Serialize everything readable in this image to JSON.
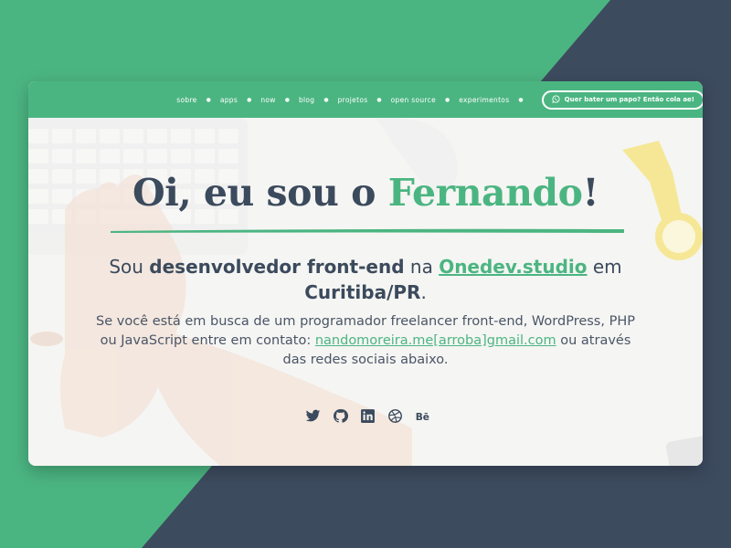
{
  "colors": {
    "accent": "#4bb581",
    "dark": "#3b4a5c",
    "background_dark": "#3d4b5f"
  },
  "nav": {
    "items": [
      {
        "label": "sobre"
      },
      {
        "label": "apps"
      },
      {
        "label": "now"
      },
      {
        "label": "blog"
      },
      {
        "label": "projetos"
      },
      {
        "label": "open source"
      },
      {
        "label": "experimentos"
      }
    ],
    "cta_label": "Quer bater um papo? Então cola ae!",
    "cta_icon": "whatsapp-icon"
  },
  "hero": {
    "title_pre": "Oi, eu sou o ",
    "title_name": "Fernando",
    "title_post": "!",
    "tag_1": "Sou ",
    "tag_bold": "desenvolvedor front-end",
    "tag_2": " na ",
    "tag_link": "Onedev.studio",
    "tag_3": " em ",
    "tag_city": "Curitiba/PR",
    "tag_4": ".",
    "desc_1": "Se você está em busca de um programador freelancer front-end, WordPress, PHP ou JavaScript entre em contato: ",
    "desc_email": "nandomoreira.me[arroba]gmail.com",
    "desc_2": " ou através das redes sociais abaixo."
  },
  "social": [
    "twitter-icon",
    "github-icon",
    "linkedin-icon",
    "dribbble-icon",
    "behance-icon"
  ]
}
